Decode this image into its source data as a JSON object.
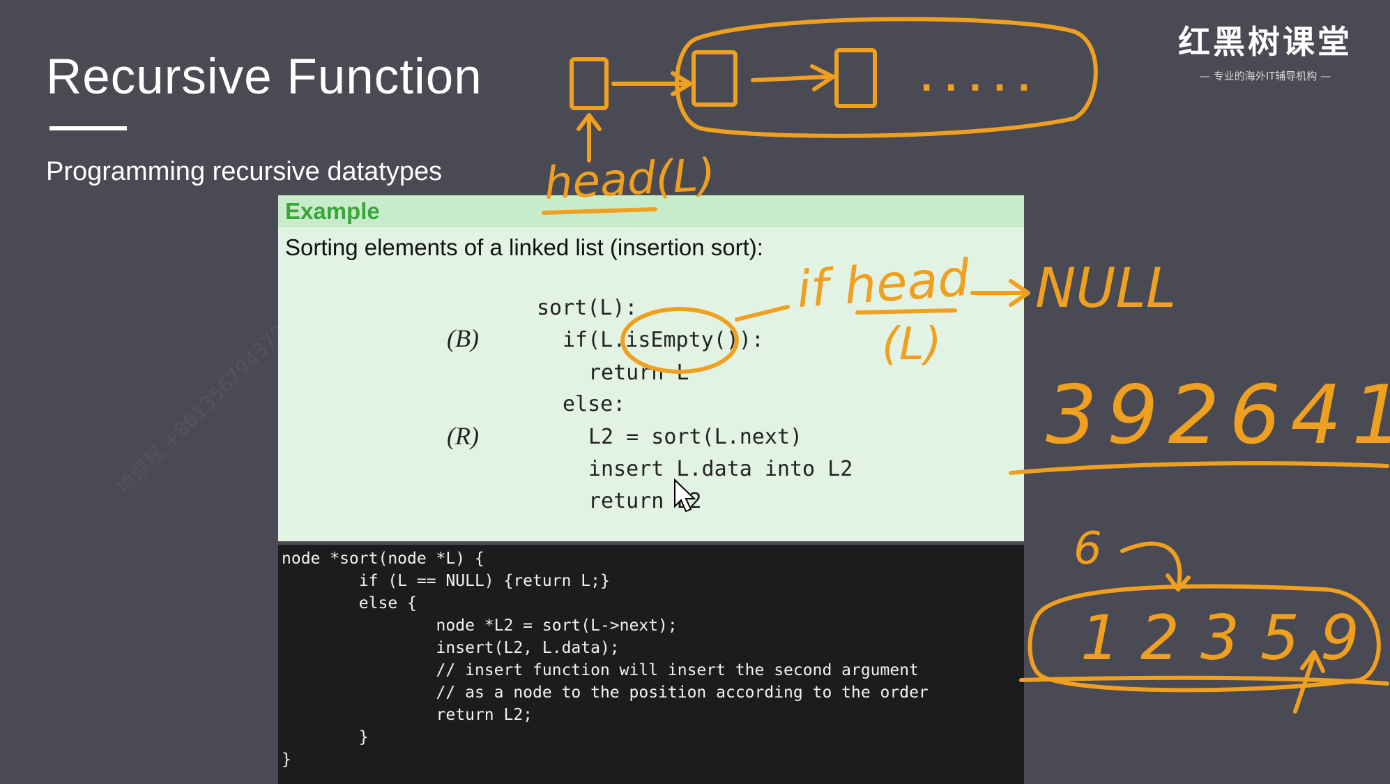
{
  "slide": {
    "title": "Recursive Function",
    "subtitle": "Programming recursive datatypes"
  },
  "brand": {
    "name": "红黑树课堂",
    "tagline": "— 专业的海外IT辅导机构 —"
  },
  "example": {
    "header": "Example",
    "description": "Sorting elements of a linked list (insertion sort):",
    "labels": {
      "base": "(B)",
      "recursive": "(R)"
    },
    "algorithm": [
      "sort(L):",
      "if(L.isEmpty()):",
      "return L",
      "else:",
      "L2 = sort(L.next)",
      "insert  L.data into  L2",
      "return L2"
    ]
  },
  "code": {
    "lines": [
      "node *sort(node *L) {",
      "        if (L == NULL) {return L;}",
      "        else {",
      "                node *L2 = sort(L->next);",
      "                insert(L2, L.data);",
      "                // insert function will insert the second argument",
      "                // as a node to the position according to the order",
      "                return L2;",
      "        }",
      "}"
    ]
  },
  "annotations": {
    "head_l": "head(L)",
    "if_head": "if head",
    "l_paren": "(L)",
    "null_text": "NULL",
    "number_sequence": "392641",
    "six": "6",
    "sorted_sequence": "12359",
    "dots": ". . . . ."
  },
  "watermark": "项烦程 +8613567943726",
  "colors": {
    "background": "#4a4a54",
    "example_bg": "#e3f3e3",
    "example_header_bg": "#c8eccb",
    "example_header_text": "#3aa53a",
    "code_bg": "#1c1c1e",
    "handwriting": "#f0a020"
  }
}
